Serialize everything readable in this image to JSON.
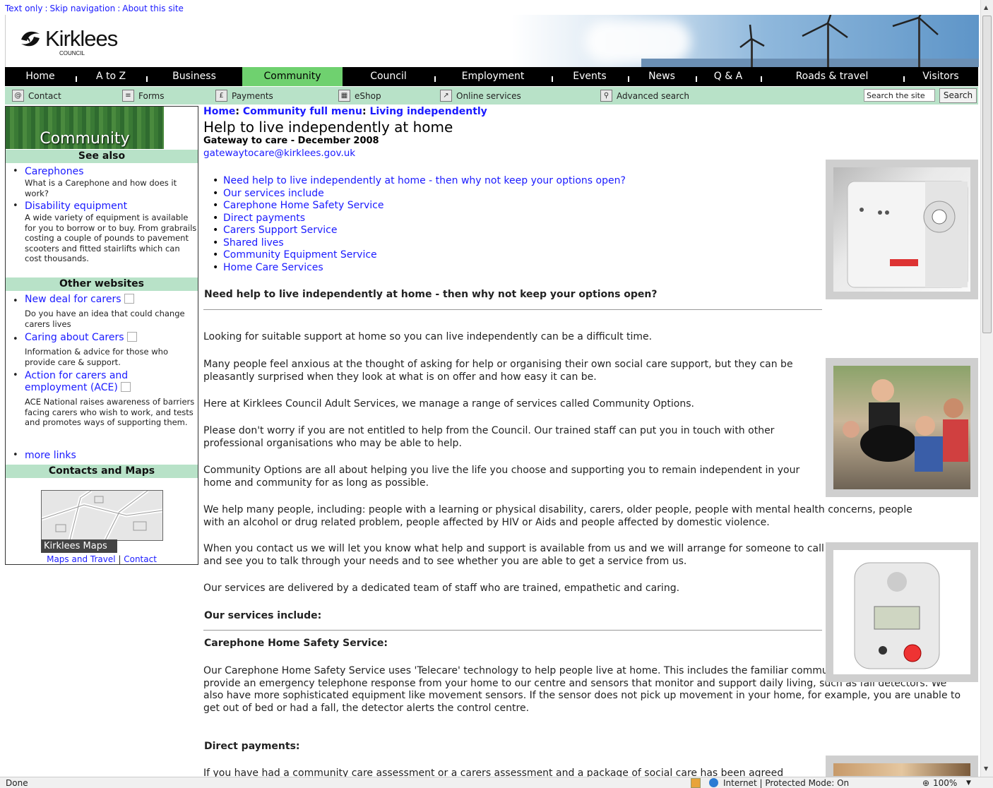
{
  "top_links": [
    "Text only",
    "Skip navigation",
    "About this site"
  ],
  "logo": {
    "name": "Kirklees",
    "sub": "COUNCIL"
  },
  "main_nav": [
    "Home",
    "A to Z",
    "Business",
    "Community",
    "Council",
    "Employment",
    "Events",
    "News",
    "Q & A",
    "Roads & travel",
    "Visitors"
  ],
  "main_nav_active": "Community",
  "sub_nav": {
    "items": [
      {
        "label": "Contact",
        "icon": "at-icon"
      },
      {
        "label": "Forms",
        "icon": "form-icon"
      },
      {
        "label": "Payments",
        "icon": "pound-icon"
      },
      {
        "label": "eShop",
        "icon": "basket-icon"
      },
      {
        "label": "Online services",
        "icon": "online-icon"
      },
      {
        "label": "Advanced search",
        "icon": "magnifier-icon"
      }
    ],
    "search_placeholder": "Search the site",
    "search_button": "Search"
  },
  "sidebar": {
    "banner": "Community",
    "see_also_heading": "See also",
    "see_also": [
      {
        "title": "Carephones",
        "desc": "What is a Carephone and how does it work?"
      },
      {
        "title": "Disability equipment",
        "desc": "A wide variety of equipment is available for you to borrow or to buy. From grabrails costing a couple of pounds to pavement scooters and fitted stairlifts which can cost thousands."
      }
    ],
    "other_heading": "Other websites",
    "other": [
      {
        "title": "New deal for carers",
        "desc": "Do you have an idea that could change carers lives"
      },
      {
        "title": "Caring about Carers",
        "desc": "Information & advice for those who provide care & support."
      },
      {
        "title": "Action for carers and employment (ACE)",
        "desc": "ACE National raises awareness of barriers facing carers who wish to work, and tests and promotes ways of supporting them."
      }
    ],
    "more_links": "more links",
    "contacts_heading": "Contacts and Maps",
    "map_label": "Kirklees Maps",
    "map_link1": "Maps and Travel",
    "map_link2": "Contact"
  },
  "content": {
    "breadcrumb": [
      "Home",
      "Community full menu",
      "Living independently"
    ],
    "title": "Help to live independently at home",
    "subtitle": "Gateway to care - December 2008",
    "email": "gatewaytocare@kirklees.gov.uk",
    "toc": [
      "Need help to live independently at home - then why not keep your options open?",
      "Our services include",
      "Carephone Home Safety Service",
      "Direct payments",
      "Carers Support Service",
      "Shared lives",
      "Community Equipment Service",
      "Home Care Services"
    ],
    "section1": "Need help to live independently at home - then why not keep your options open?",
    "p1": "Looking for suitable support at home so you can live independently can be a difficult time.",
    "p2": "Many people feel anxious at the thought of asking for help or organising their own social care support, but they can be pleasantly surprised when they look at what is on offer and how easy it can be.",
    "p3": "Here at Kirklees Council Adult Services, we manage a range of services called Community Options.",
    "p4": "Please don't worry if you are not entitled to help from the Council. Our trained staff can put you in touch with other professional organisations who may be able to help.",
    "p5": "Community Options are all about helping you live the life you choose and supporting you to remain independent in your home and community for as long as possible.",
    "p6": "We help many people, including: people with a learning or physical disability, carers, older people, people with mental health concerns, people with an alcohol or drug related problem, people affected by HIV or Aids and people affected by domestic violence.",
    "p7": "When you contact us we will let you know what help and support is available from us and we will arrange for someone to call and see you to talk through your needs and to see whether you are able to get a service from us.",
    "p8": "Our services are delivered by a dedicated team of staff who are trained, empathetic and caring.",
    "section2": "Our services include:",
    "section3": "Carephone Home Safety Service:",
    "p9": "Our Carephone Home Safety Service uses 'Telecare' technology to help people live at home. This includes the familiar community alarm services that provide an emergency telephone response from your home to our centre and sensors that monitor and support daily living, such as fall detectors. We also have more sophisticated equipment like movement sensors. If the sensor does not pick up movement in your home, for example, you are unable to get out of bed or had a fall, the detector alerts the control centre.",
    "section4": "Direct payments:",
    "p10": "If you have had a community care assessment or a carers assessment and a package of social care has been agreed"
  },
  "status": {
    "left": "Done",
    "zone": "Internet | Protected Mode: On",
    "zoom": "100%"
  }
}
